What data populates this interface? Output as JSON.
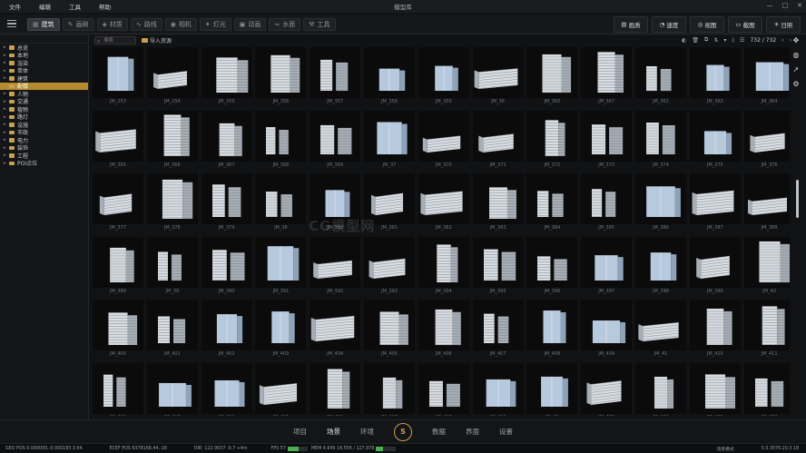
{
  "menu": {
    "items": [
      "文件",
      "编辑",
      "工具",
      "帮助"
    ],
    "title": "模型库"
  },
  "tabs": [
    {
      "label": "建筑",
      "glyph": "▦",
      "active": true
    },
    {
      "label": "画刷",
      "glyph": "✎",
      "active": false
    },
    {
      "label": "材质",
      "glyph": "◈",
      "active": false
    },
    {
      "label": "路线",
      "glyph": "∿",
      "active": false
    },
    {
      "label": "相机",
      "glyph": "◉",
      "active": false
    },
    {
      "label": "灯光",
      "glyph": "✦",
      "active": false
    },
    {
      "label": "动画",
      "glyph": "▣",
      "active": false
    },
    {
      "label": "水面",
      "glyph": "≈",
      "active": false
    },
    {
      "label": "工具",
      "glyph": "⚒",
      "active": false
    }
  ],
  "right_tools": [
    {
      "label": "画质",
      "glyph": "▤"
    },
    {
      "label": "速度",
      "glyph": "◔"
    },
    {
      "label": "视图",
      "glyph": "◎"
    },
    {
      "label": "截图",
      "glyph": "▭"
    },
    {
      "label": "日照",
      "glyph": "☀"
    }
  ],
  "tree": [
    {
      "label": "总览",
      "arrow": "▸"
    },
    {
      "label": "本地",
      "arrow": "▸"
    },
    {
      "label": "渲染",
      "arrow": "▸"
    },
    {
      "label": "单体",
      "arrow": "▸"
    },
    {
      "label": "建筑",
      "arrow": "▸"
    },
    {
      "label": "配楼",
      "arrow": "▸",
      "selected": true
    },
    {
      "label": "人物",
      "arrow": "▸"
    },
    {
      "label": "交通",
      "arrow": "▸"
    },
    {
      "label": "植物",
      "arrow": "▸"
    },
    {
      "label": "路灯",
      "arrow": "▸"
    },
    {
      "label": "设施",
      "arrow": "▸"
    },
    {
      "label": "市政",
      "arrow": "▸"
    },
    {
      "label": "电力",
      "arrow": "▸"
    },
    {
      "label": "装饰",
      "arrow": "▸"
    },
    {
      "label": "工程",
      "arrow": "▸"
    },
    {
      "label": "POI点位",
      "arrow": "▸"
    }
  ],
  "search": {
    "placeholder": "搜索",
    "icon": "search-icon"
  },
  "import_label": "导入资源",
  "page_counter": "732 / 732",
  "tiles": [
    [
      "JM_253",
      "JM_254",
      "JM_255",
      "JM_356",
      "JM_357",
      "JM_358",
      "JM_359",
      "JM_36",
      "JM_360",
      "JM_367",
      "JM_362",
      "JM_363",
      "JM_364"
    ],
    [
      "JM_365",
      "JM_366",
      "JM_367",
      "JM_368",
      "JM_369",
      "JM_37",
      "JM_370",
      "JM_371",
      "JM_372",
      "JM_373",
      "JM_374",
      "JM_375",
      "JM_376"
    ],
    [
      "JM_377",
      "JM_378",
      "JM_379",
      "JM_38",
      "JM_380",
      "JM_381",
      "JM_382",
      "JM_383",
      "JM_384",
      "JM_385",
      "JM_386",
      "JM_387",
      "JM_388"
    ],
    [
      "JM_389",
      "JM_39",
      "JM_390",
      "JM_391",
      "JM_392",
      "JM_393",
      "JM_394",
      "JM_395",
      "JM_396",
      "JM_397",
      "JM_398",
      "JM_399",
      "JM_40"
    ],
    [
      "JM_400",
      "JM_401",
      "JM_402",
      "JM_403",
      "JM_404",
      "JM_405",
      "JM_406",
      "JM_407",
      "JM_408",
      "JM_409",
      "JM_41",
      "JM_410",
      "JM_411"
    ],
    [
      "JM_412",
      "JM_413",
      "JM_414",
      "JM_415",
      "JM_416",
      "JM_417",
      "JM_418",
      "JM_419",
      "JM_42",
      "JM_420",
      "JM_421",
      "JM_422",
      "JM_423"
    ]
  ],
  "bottom_nav": {
    "items": [
      "项目",
      "场景",
      "环境",
      "数据",
      "界面",
      "设置"
    ],
    "active": "场景",
    "logo": "S"
  },
  "status": {
    "geo": "GEO POS 0.000000,-0.000183.3.94",
    "ecef": "ECEF POS 6378168.44,-18",
    "dir": "DIR -122.9037 -0.7 +4m",
    "fps": "FPS 57",
    "mem": "MEM 4,649 14,556 / 127,978",
    "vmem_pct": 0.55,
    "mem_pct": 0.35,
    "scene_mode": "场景模式",
    "right": "5.0.3076.20.3.18"
  },
  "watermark": "CG模型网"
}
